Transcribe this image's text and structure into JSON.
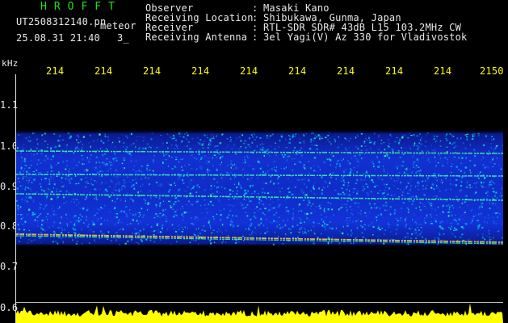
{
  "header": {
    "title": "HROFFT",
    "filename": "UT2508312140.pn",
    "meteor_label": "meteor",
    "datetime": "25.08.31 21:40",
    "count": "3_",
    "info": [
      {
        "label": "Observer",
        "value": "Masaki Kano"
      },
      {
        "label": "Receiving Location",
        "value": "Shibukawa, Gunma, Japan"
      },
      {
        "label": "Receiver",
        "value": "RTL-SDR SDR# 43dB L15 103.2MHz CW"
      },
      {
        "label": "Receiving Antenna",
        "value": "3el Yagi(V) Az 330 for Vladivostok"
      }
    ],
    "separator": ":"
  },
  "axes": {
    "y_unit": "kHz",
    "x_ticks": [
      "214",
      "214",
      "214",
      "214",
      "214",
      "214",
      "214",
      "214",
      "214",
      "2150"
    ],
    "y_ticks": [
      "1.1",
      "1.0",
      "0.9",
      "0.8",
      "0.7",
      "0.6"
    ]
  },
  "colors": {
    "background": "#000000",
    "text_green": "#1de01d",
    "text_white": "#e8e8e8",
    "text_yellow": "#ffff00",
    "spectrum_low": "#0a1fd0",
    "spectrum_mid": "#00c8ff",
    "spectrum_high": "#7cff7c",
    "noise_floor": "#ffff00"
  }
}
